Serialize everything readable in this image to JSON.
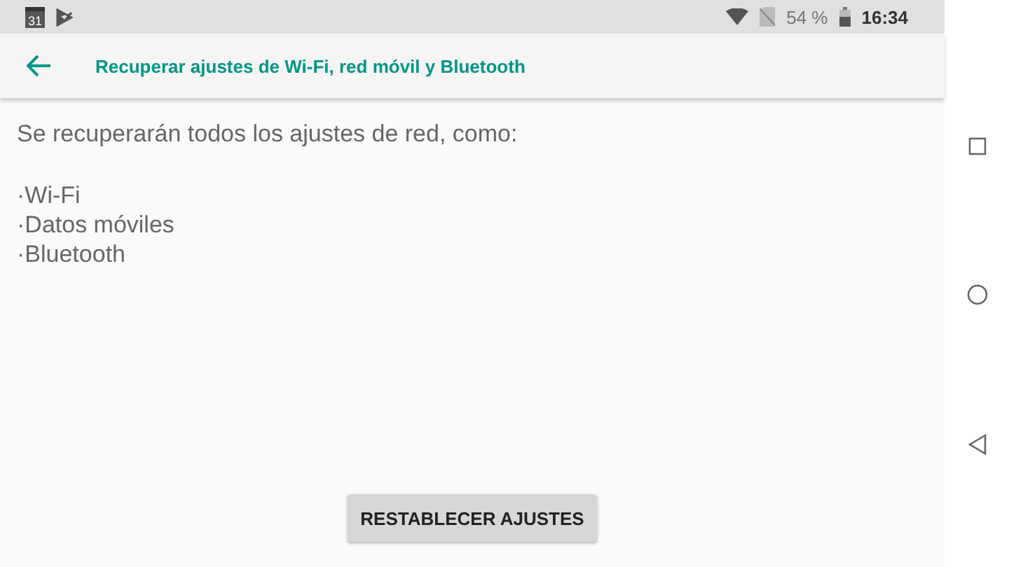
{
  "status_bar": {
    "calendar_day": "31",
    "battery": "54 %",
    "time": "16:34"
  },
  "app_bar": {
    "title": "Recuperar ajustes de Wi-Fi, red móvil y Bluetooth"
  },
  "content": {
    "intro": "Se recuperarán todos los ajustes de red, como:",
    "items": [
      "·Wi-Fi",
      "·Datos móviles",
      "·Bluetooth"
    ]
  },
  "button": {
    "label": "RESTABLECER AJUSTES"
  }
}
